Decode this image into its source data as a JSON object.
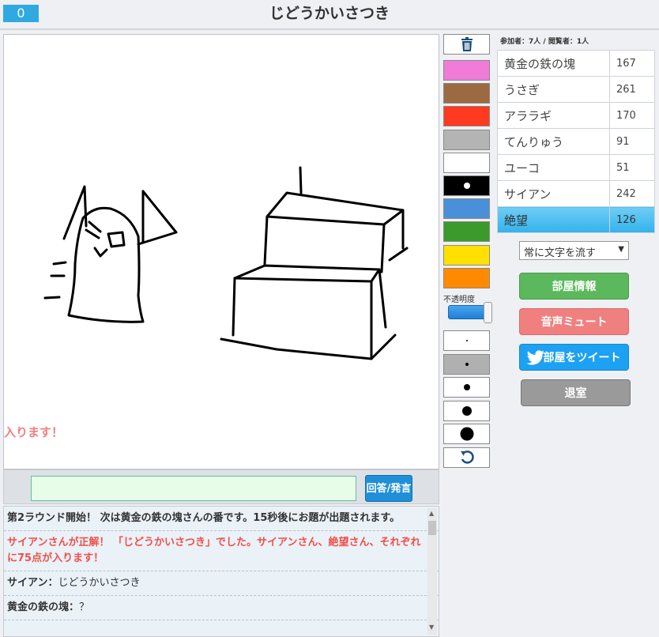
{
  "header": {
    "timer": "0",
    "title": "じどうかいさつき"
  },
  "canvas": {
    "overflow_text": "入ります！"
  },
  "input": {
    "value": "",
    "send_label": "回答/発言"
  },
  "chat": {
    "messages": [
      {
        "text": "第2ラウンド開始！ 次は黄金の鉄の塊さんの番です。15秒後にお題が出題されます。",
        "style": "dark"
      },
      {
        "text": "サイアンさんが正解！ 「じどうかいさつき」でした。サイアンさん、絶望さん、それぞれに75点が入ります！",
        "style": "red"
      },
      {
        "name": "サイアン",
        "sep": "：",
        "text": "じどうかいさつき"
      },
      {
        "name": "黄金の鉄の塊",
        "sep": "：",
        "text": "？"
      }
    ]
  },
  "palette": {
    "colors": [
      "#f07bd8",
      "#9c6a40",
      "#ff3a20",
      "#b4b4b4",
      "#ffffff",
      "#000000",
      "#4a90d9",
      "#3a9a2a",
      "#ffe000",
      "#ff8a00"
    ],
    "selected_color": "#000000",
    "opacity_label": "不透明度",
    "opacity": 1.0,
    "pen_sizes": [
      1,
      2,
      3,
      4,
      5
    ],
    "selected_pen": 2
  },
  "room": {
    "counts_text": "参加者：7人 / 閲覧者：1人",
    "players": [
      {
        "name": "黄金の鉄の塊",
        "score": "167"
      },
      {
        "name": "うさぎ",
        "score": "261"
      },
      {
        "name": "アララギ",
        "score": "170"
      },
      {
        "name": "てんりゅう",
        "score": "91"
      },
      {
        "name": "ユーコ",
        "score": "51"
      },
      {
        "name": "サイアン",
        "score": "242"
      },
      {
        "name": "絶望",
        "score": "126",
        "active": true
      }
    ],
    "scroll_option": "常に文字を流す",
    "buttons": {
      "room_info": "部屋情報",
      "mute": "音声ミュート",
      "tweet": "部屋をツイート",
      "exit": "退室"
    }
  }
}
